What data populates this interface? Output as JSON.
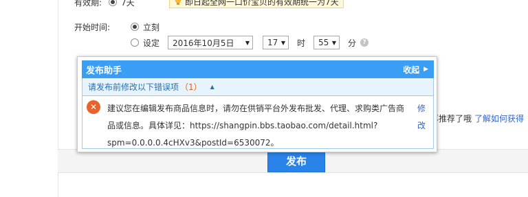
{
  "validity": {
    "label": "有效期:",
    "value": "7天",
    "hint": "即日起全网一口价宝贝的有效期统一为7天"
  },
  "start_time": {
    "label": "开始时间:",
    "now_label": "立刻",
    "set_label": "设定",
    "date_value": "2016年10月5日",
    "hour_value": "17",
    "hour_unit": "时",
    "minute_value": "55",
    "minute_unit": "分",
    "help_icon": "?"
  },
  "recommend": {
    "text": "再推荐了哦",
    "link": "了解如何获得"
  },
  "publish_button": "发布",
  "assistant": {
    "title": "发布助手",
    "collapse_label": "收起",
    "errors_prefix": "请发布前修改以下错误项",
    "errors_count": "（1）",
    "error_icon": "✕",
    "error_message": "建议您在编辑发布商品信息时，请勿在供销平台外发布批发、代理、求购类广告商品或信息。具体详见：https://shangpin.bbs.taobao.com/detail.html?spm=0.0.0.0.4cHXv3&postId=6530072。",
    "fix_link": "修改"
  },
  "colors": {
    "header_blue": "#3a9ef4",
    "link_blue": "#3366cc",
    "error_orange": "#e8622a",
    "button_blue": "#2a83e9"
  },
  "icons": [
    "bulb-icon",
    "question-icon",
    "chevron-right-icon",
    "caret-up-icon",
    "error-x-icon",
    "dropdown-arrow-icon"
  ]
}
